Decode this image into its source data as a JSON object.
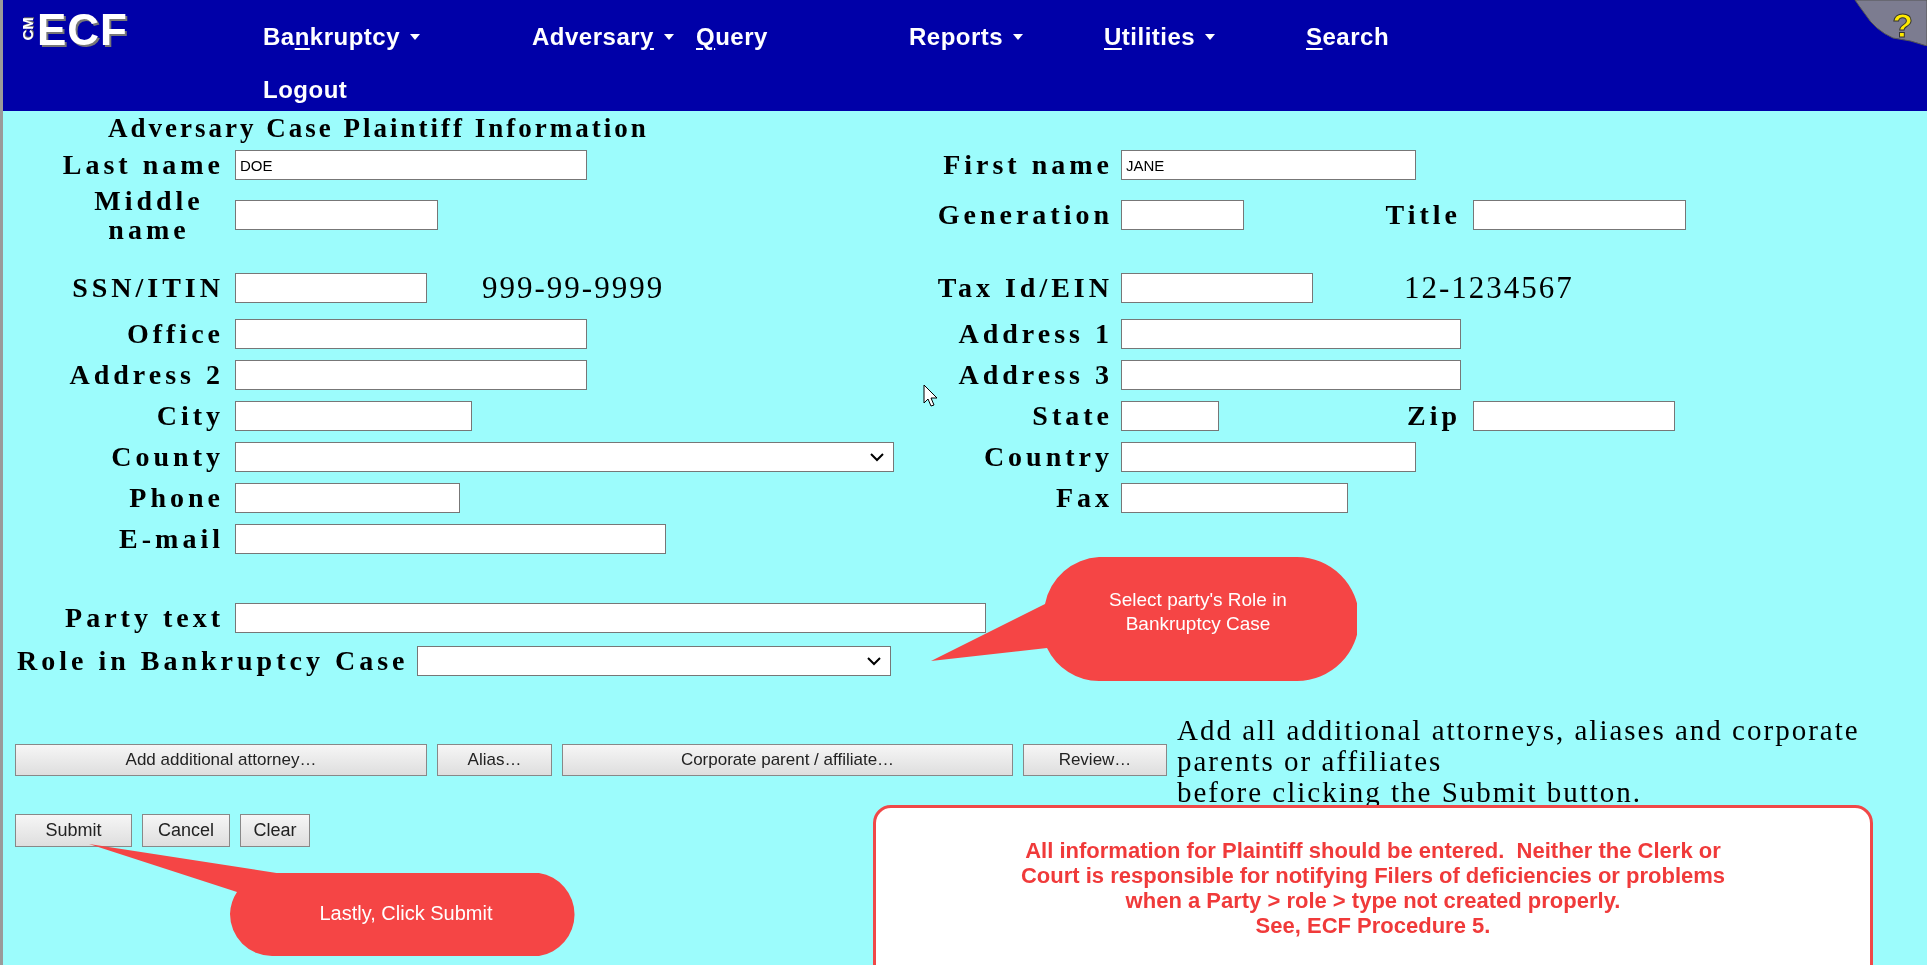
{
  "logo": {
    "small": "CM",
    "large": "ECF"
  },
  "menu": [
    {
      "before": "Ba",
      "key": "n",
      "after": "kruptcy",
      "dropdown": true
    },
    {
      "before": "Adversar",
      "key": "y",
      "dropdown": true
    },
    {
      "key": "Q",
      "after": "uery",
      "dropdown": false
    },
    {
      "before": "Reports",
      "dropdown": true
    },
    {
      "key": "U",
      "after": "tilities",
      "dropdown": true
    },
    {
      "key": "S",
      "after": "earch",
      "dropdown": false
    },
    {
      "before": "Logout",
      "dropdown": false
    }
  ],
  "help": {
    "label": "?"
  },
  "form": {
    "title": "Adversary Case Plaintiff Information",
    "rows": [
      {
        "fields": [
          {
            "label": "Last name",
            "kind": "text",
            "value": "DOE"
          },
          {
            "label": "First name",
            "kind": "text",
            "value": "JANE"
          }
        ]
      },
      {
        "fields": [
          {
            "label": "Middle name",
            "kind": "text"
          },
          {
            "label": "Generation",
            "kind": "text"
          },
          {
            "label": "Title",
            "kind": "text"
          }
        ]
      },
      {
        "fields": [
          {
            "label": "SSN/ITIN",
            "kind": "text",
            "note": "999-99-9999"
          },
          {
            "label": "Tax Id/EIN",
            "kind": "text",
            "note": "12-1234567"
          }
        ]
      },
      {
        "fields": [
          {
            "label": "Office",
            "kind": "text"
          },
          {
            "label": "Address 1",
            "kind": "text"
          }
        ]
      },
      {
        "fields": [
          {
            "label": "Address 2",
            "kind": "text"
          },
          {
            "label": "Address 3",
            "kind": "text"
          }
        ]
      },
      {
        "fields": [
          {
            "label": "City",
            "kind": "text"
          },
          {
            "label": "State",
            "kind": "text"
          },
          {
            "label": "Zip",
            "kind": "text"
          }
        ]
      },
      {
        "fields": [
          {
            "label": "County",
            "kind": "select"
          },
          {
            "label": "Country",
            "kind": "text"
          }
        ]
      },
      {
        "fields": [
          {
            "label": "Phone",
            "kind": "text"
          },
          {
            "label": "Fax",
            "kind": "text"
          }
        ]
      },
      {
        "fields": [
          {
            "label": "E-mail",
            "kind": "text"
          }
        ]
      }
    ],
    "party_text": {
      "label": "Party text",
      "kind": "text"
    },
    "role": {
      "label": "Role in Bankruptcy Case",
      "kind": "select"
    }
  },
  "extra_buttons": [
    "Add additional attorney…",
    "Alias…",
    "Corporate parent / affiliate…",
    "Review…"
  ],
  "extra_note": "Add all additional attorneys, aliases and corporate\nparents or affiliates\nbefore clicking the Submit button.",
  "actions": [
    "Submit",
    "Cancel",
    "Clear"
  ],
  "callouts": [
    {
      "text": "Select party's Role in\nBankruptcy Case"
    },
    {
      "text": "Lastly, Click Submit"
    }
  ],
  "notice": "All information for Plaintiff should be entered.  Neither the Clerk or\nCourt is responsible for notifying Filers of deficiencies or problems\nwhen a Party > role > type not created properly.\nSee, ECF Procedure 5."
}
